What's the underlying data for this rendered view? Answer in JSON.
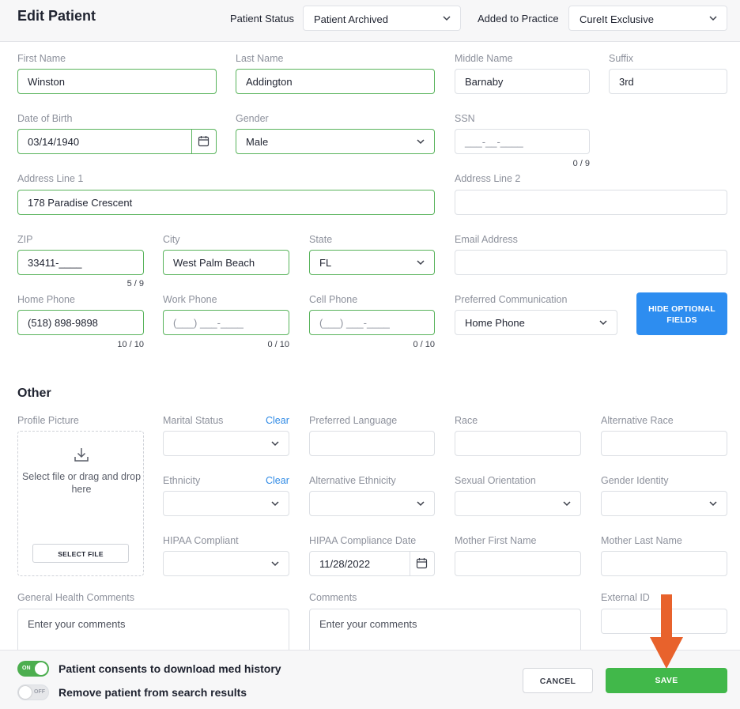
{
  "header": {
    "title": "Edit Patient",
    "patient_status_label": "Patient Status",
    "patient_status_value": "Patient Archived",
    "added_to_practice_label": "Added to Practice",
    "added_to_practice_value": "CureIt Exclusive"
  },
  "demographics": {
    "first_name": {
      "label": "First Name",
      "value": "Winston"
    },
    "last_name": {
      "label": "Last Name",
      "value": "Addington"
    },
    "middle_name": {
      "label": "Middle Name",
      "value": "Barnaby"
    },
    "suffix": {
      "label": "Suffix",
      "value": "3rd"
    },
    "dob": {
      "label": "Date of Birth",
      "value": "03/14/1940"
    },
    "gender": {
      "label": "Gender",
      "value": "Male"
    },
    "ssn": {
      "label": "SSN",
      "value": "___-__-____",
      "counter": "0 / 9"
    },
    "address1": {
      "label": "Address Line 1",
      "value": "178 Paradise Crescent"
    },
    "address2": {
      "label": "Address Line 2",
      "value": ""
    },
    "zip": {
      "label": "ZIP",
      "value": "33411-____",
      "counter": "5 / 9"
    },
    "city": {
      "label": "City",
      "value": "West Palm Beach"
    },
    "state": {
      "label": "State",
      "value": "FL"
    },
    "email": {
      "label": "Email Address",
      "value": ""
    },
    "home_phone": {
      "label": "Home Phone",
      "value": "(518) 898-9898",
      "counter": "10 / 10"
    },
    "work_phone": {
      "label": "Work Phone",
      "value": "(___) ___-____",
      "counter": "0 / 10"
    },
    "cell_phone": {
      "label": "Cell Phone",
      "value": "(___) ___-____",
      "counter": "0 / 10"
    },
    "preferred_comm": {
      "label": "Preferred Communication",
      "value": "Home Phone"
    },
    "hide_optional_label": "HIDE OPTIONAL FIELDS"
  },
  "other": {
    "section_title": "Other",
    "profile_picture_label": "Profile Picture",
    "dropzone_text": "Select file or drag and drop here",
    "select_file_label": "SELECT FILE",
    "marital_status_label": "Marital Status",
    "clear_label": "Clear",
    "preferred_language_label": "Preferred Language",
    "race_label": "Race",
    "alternative_race_label": "Alternative Race",
    "ethnicity_label": "Ethnicity",
    "alternative_ethnicity_label": "Alternative Ethnicity",
    "sexual_orientation_label": "Sexual Orientation",
    "gender_identity_label": "Gender Identity",
    "hipaa_compliant_label": "HIPAA Compliant",
    "hipaa_date_label": "HIPAA Compliance Date",
    "hipaa_date_value": "11/28/2022",
    "mother_first_label": "Mother First Name",
    "mother_last_label": "Mother Last Name",
    "health_comments_label": "General Health Comments",
    "health_comments_placeholder": "Enter your comments",
    "comments_label": "Comments",
    "comments_placeholder": "Enter your comments",
    "external_id_label": "External ID"
  },
  "footer": {
    "consent_toggle_state": "ON",
    "consent_label": "Patient consents to download med history",
    "remove_toggle_state": "OFF",
    "remove_label": "Remove patient from search results",
    "cancel_label": "CANCEL",
    "save_label": "SAVE"
  },
  "colors": {
    "valid_border": "#58b35b",
    "primary_blue": "#2d8df0",
    "save_green": "#41b84a",
    "annotation_arrow": "#e8622c"
  }
}
